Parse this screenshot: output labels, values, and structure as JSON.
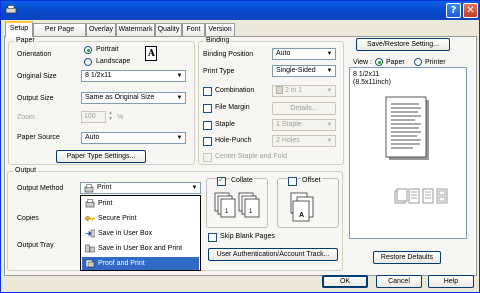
{
  "window": {
    "title": ""
  },
  "tabs": [
    "Setup",
    "Per Page Setting",
    "Overlay",
    "Watermark",
    "Quality",
    "Font",
    "Version"
  ],
  "paper": {
    "group_title": "Paper",
    "orientation_label": "Orientation",
    "portrait_label": "Portrait",
    "landscape_label": "Landscape",
    "orientation_selected": "Portrait",
    "orientation_icon_text": "A",
    "original_size_label": "Original Size",
    "original_size_value": "8 1/2x11",
    "output_size_label": "Output Size",
    "output_size_value": "Same as Original Size",
    "zoom_label": "Zoom",
    "zoom_value": "100",
    "zoom_unit": "%",
    "paper_source_label": "Paper Source",
    "paper_source_value": "Auto",
    "paper_type_button": "Paper Type Settings..."
  },
  "binding": {
    "group_title": "Binding",
    "binding_position_label": "Binding Position",
    "binding_position_value": "Auto",
    "print_type_label": "Print Type",
    "print_type_value": "Single-Sided",
    "combination_label": "Combination",
    "combination_value": "2 in 1",
    "file_margin_label": "File Margin",
    "details_button": "Details...",
    "staple_label": "Staple",
    "staple_value": "1 Staple",
    "hole_punch_label": "Hole-Punch",
    "hole_punch_value": "2 Holes",
    "center_staple_label": "Center Staple and Fold"
  },
  "preview": {
    "save_restore_button": "Save/Restore Setting...",
    "view_label": "View :",
    "paper_label": "Paper",
    "printer_label": "Printer",
    "view_selected": "Paper",
    "size_line1": "8 1/2x11",
    "size_line2": "(8.5x11inch)"
  },
  "output": {
    "group_title": "Output",
    "output_method_label": "Output Method",
    "output_method_value": "Print",
    "copies_label": "Copies",
    "output_tray_label": "Output Tray",
    "collate_label": "Collate",
    "collate_checked": true,
    "offset_label": "Offset",
    "offset_checked": false,
    "skip_blank_label": "Skip Blank Pages",
    "user_auth_button": "User Authentication/Account Track...",
    "dropdown_items": [
      {
        "label": "Print",
        "icon": "printer-icon"
      },
      {
        "label": "Secure Print",
        "icon": "key-icon"
      },
      {
        "label": "Save in User Box",
        "icon": "save-box-icon"
      },
      {
        "label": "Save in User Box and Print",
        "icon": "save-box-print-icon"
      },
      {
        "label": "Proof and Print",
        "icon": "proof-print-icon"
      }
    ],
    "dropdown_selected": "Proof and Print"
  },
  "footer": {
    "restore_defaults_button": "Restore Defaults",
    "ok_button": "OK",
    "cancel_button": "Cancel",
    "help_button": "Help"
  },
  "colors": {
    "titlebar": "#0a5fe8",
    "selection": "#316ac5",
    "check_green": "#21a121",
    "active_tab_accent": "#ffc83c"
  }
}
